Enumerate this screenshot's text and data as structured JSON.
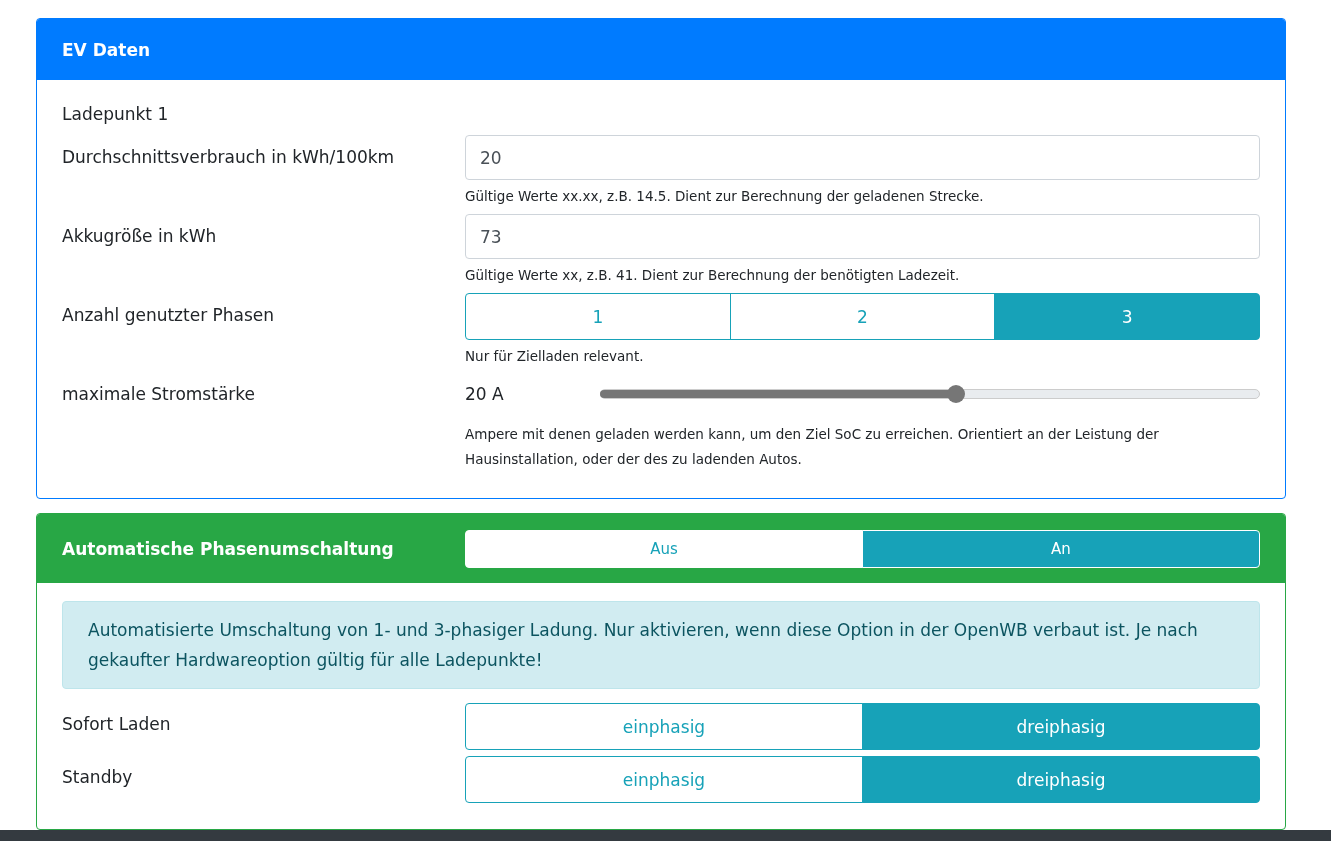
{
  "ev_card": {
    "title": "EV Daten",
    "section_label": "Ladepunkt 1",
    "fields": [
      {
        "kind": "input",
        "label": "Durchschnittsverbrauch in kWh/100km",
        "value": "20",
        "help": "Gültige Werte xx.xx, z.B. 14.5. Dient zur Berechnung der geladenen Strecke."
      },
      {
        "kind": "input",
        "label": "Akkugröße in kWh",
        "value": "73",
        "help": "Gültige Werte xx, z.B. 41. Dient zur Berechnung der benötigten Ladezeit."
      },
      {
        "kind": "buttons",
        "label": "Anzahl genutzter Phasen",
        "options": [
          {
            "label": "1",
            "selected": false
          },
          {
            "label": "2",
            "selected": false
          },
          {
            "label": "3",
            "selected": true
          }
        ],
        "help": "Nur für Zielladen relevant."
      },
      {
        "kind": "slider",
        "label": "maximale Stromstärke",
        "reading": "20 A",
        "level": 0.54,
        "help": "Ampere mit denen geladen werden kann, um den Ziel SoC zu erreichen. Orientiert an der Leistung der Hausinstallation, oder der des zu ladenden Autos."
      }
    ]
  },
  "phase_card": {
    "title": "Automatische Phasenumschaltung",
    "toggle": [
      {
        "label": "Aus",
        "selected": false
      },
      {
        "label": "An",
        "selected": true
      }
    ],
    "alert": "Automatisierte Umschaltung von 1- und 3-phasiger Ladung. Nur aktivieren, wenn diese Option in der OpenWB verbaut ist. Je nach gekaufter Hardwareoption gültig für alle Ladepunkte!",
    "rows": [
      {
        "label": "Sofort Laden",
        "options": [
          {
            "label": "einphasig",
            "selected": false
          },
          {
            "label": "dreiphasig",
            "selected": true
          }
        ]
      },
      {
        "label": "Standby",
        "options": [
          {
            "label": "einphasig",
            "selected": false
          },
          {
            "label": "dreiphasig",
            "selected": true
          }
        ]
      }
    ]
  }
}
